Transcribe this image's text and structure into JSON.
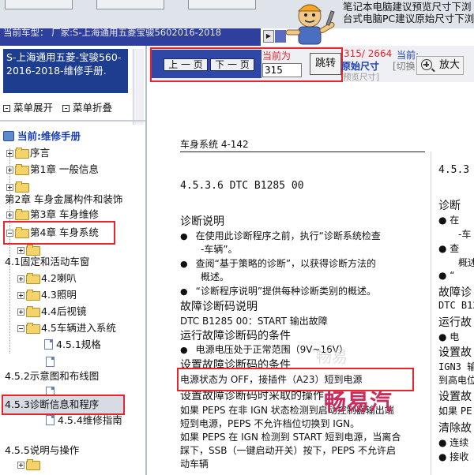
{
  "banner": {
    "tip_line1": "笔记本电脑建议预览尺寸下浏",
    "tip_line2": "台式电脑PC建议原始尺寸下浏"
  },
  "model_bar": {
    "label": "当前车型：",
    "value": "厂家:S-上海通用五菱宝骏5602016-2018"
  },
  "left_panel": {
    "title": "S-上海通用五菱-宝骏560-2016-2018-维修手册.",
    "expand_label": "菜单展开",
    "collapse_label": "菜单折叠",
    "current_label": "当前:维修手册",
    "tree": [
      "序言",
      "第1章 一般信息",
      "第2章 车身金属构件和装饰",
      "第3章 车身维修",
      "第4章 车身系统",
      "4.1固定和活动车窗",
      "4.2喇叭",
      "4.3照明",
      "4.4后视镜",
      "4.5车辆进入系统",
      "4.5.1规格",
      "4.5.2示意图和布线图",
      "4.5.3诊断信息和程序",
      "4.5.4维修指南",
      "4.5.5说明与操作"
    ]
  },
  "toolbar": {
    "prev_label": "上 一 页",
    "next_label": "下 一 页",
    "current_label": "当前为",
    "page_value": "315",
    "jump_label": "跳转",
    "page_count": "315/ 2664",
    "current2": "当前:",
    "orig_size": "原始尺寸",
    "switch_label": "[切换",
    "fit_size": "预览尺寸]",
    "zoom_label": "放大"
  },
  "doc": {
    "header": "车身系统 4-142",
    "dtc_title": "4.5.3.6 DTC B1285 00",
    "diag_title": "诊断说明",
    "b1a": "在使用此诊断程序之前，执行“诊断系统检查",
    "b1b": "-车辆”。",
    "b2a": "查阅“基于策略的诊断”，以获得诊断方法的",
    "b2b": "概述。",
    "b3": "“诊断程序说明”提供每种诊断类别的概述。",
    "code_title": "故障诊断码说明",
    "code_desc": "DTC B1285 00：START 输出故障",
    "run_cond_title": "运行故障诊断码的条件",
    "run_cond": "电源电压处于正常范围（9V~16V）",
    "set_cond_title": "设置故障诊断码的条件",
    "set_cond": "电源状态为 OFF，接插件（A23）短到电源",
    "action_title": "设置故障诊断码时采取的操作",
    "p1": "如果 PEPS 在非 IGN 状态检测到启动控制器输出端",
    "p2": "短到电源，PEPS 不允许档位切换到 IGN。",
    "p3": "如果 PEPS 在 IGN 检测到 START 短到电源，当离合",
    "p4": "踩下，SSB（一键启动开关）按下，PEPS 不允许启",
    "p5": "动车辆",
    "right_col": [
      "4.5.3",
      "诊断",
      "● 在",
      "-车",
      "● 查",
      "概述",
      "● “",
      "故障诊",
      "DTC B12",
      "运行故",
      "● 电",
      "设置故",
      "IGN3 输",
      "到高电位",
      "设置故",
      "如果 PE",
      "清除故",
      "● 连续",
      "● 接收"
    ],
    "watermark": "畅易汽",
    "watermark_faint": "畅易"
  }
}
